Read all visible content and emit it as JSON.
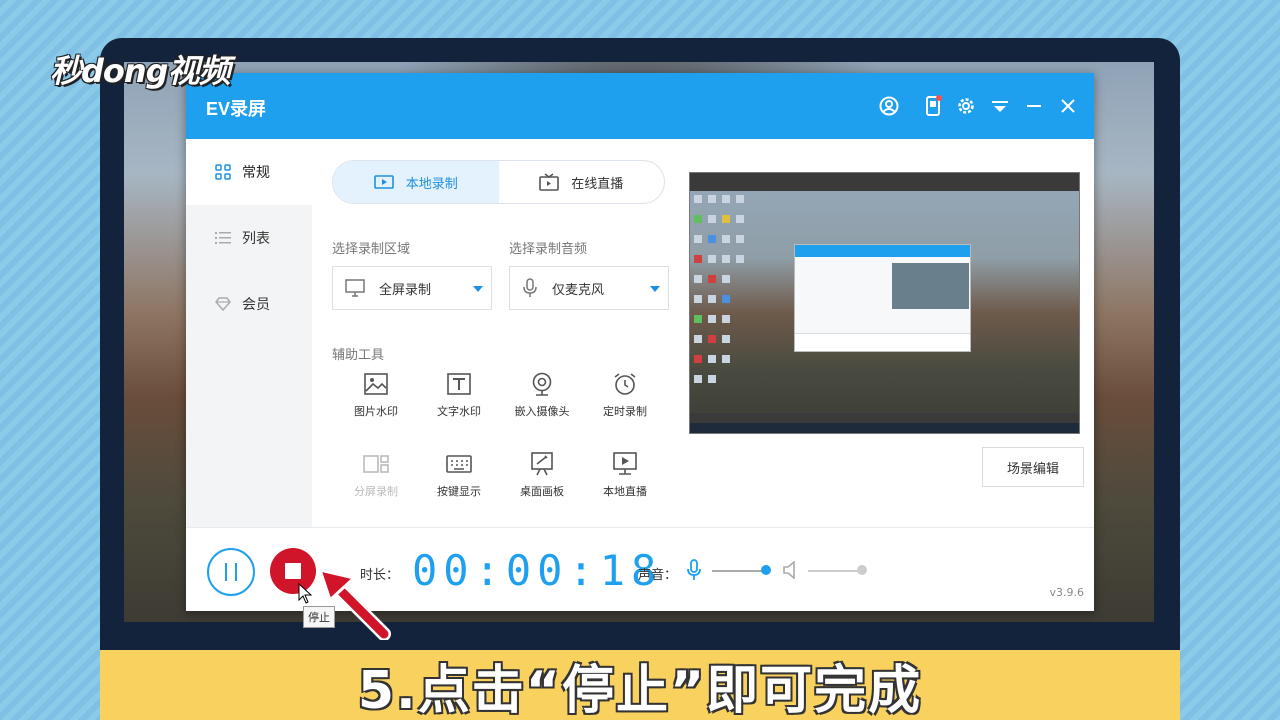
{
  "brand": {
    "logo_text": "秒dong视频"
  },
  "window": {
    "title": "EV录屏"
  },
  "sidebar": {
    "items": [
      {
        "label": "常规",
        "icon": "grid-icon"
      },
      {
        "label": "列表",
        "icon": "list-icon"
      },
      {
        "label": "会员",
        "icon": "diamond-icon"
      }
    ]
  },
  "tabs": [
    {
      "label": "本地录制",
      "icon": "record-video-icon"
    },
    {
      "label": "在线直播",
      "icon": "tv-icon"
    }
  ],
  "region": {
    "label": "选择录制区域",
    "value": "全屏录制"
  },
  "audio": {
    "label": "选择录制音频",
    "value": "仅麦克风"
  },
  "tools_label": "辅助工具",
  "tools": [
    {
      "label": "图片水印",
      "icon": "image-icon"
    },
    {
      "label": "文字水印",
      "icon": "text-icon"
    },
    {
      "label": "嵌入摄像头",
      "icon": "webcam-icon"
    },
    {
      "label": "定时录制",
      "icon": "alarm-clock-icon"
    },
    {
      "label": "分屏录制",
      "icon": "split-screen-icon",
      "disabled": true
    },
    {
      "label": "按键显示",
      "icon": "keyboard-icon"
    },
    {
      "label": "桌面画板",
      "icon": "easel-icon"
    },
    {
      "label": "本地直播",
      "icon": "monitor-play-icon"
    }
  ],
  "scene_button": "场景编辑",
  "controls": {
    "duration_label": "时长：",
    "timer": "00:00:18",
    "sound_label": "声音：",
    "tooltip": "停止",
    "version": "v3.9.6"
  },
  "caption": "5.点击“停止”即可完成",
  "colors": {
    "accent": "#1ea0ef",
    "stop": "#d0142a",
    "caption_bg": "#f9d15e"
  }
}
